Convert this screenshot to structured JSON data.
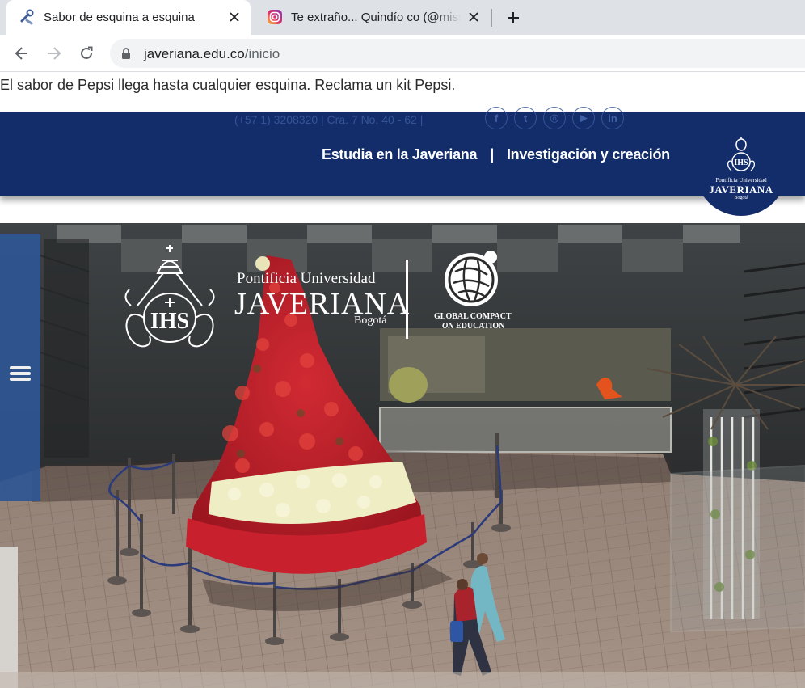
{
  "browser": {
    "tabs": [
      {
        "title": "Sabor de esquina a esquina",
        "icon": "tools-icon",
        "active": true
      },
      {
        "title": "Te extraño... Quindío co (@missin",
        "icon": "instagram-icon",
        "active": false
      }
    ],
    "url": {
      "domain": "javeriana.edu.co",
      "path": "/inicio"
    }
  },
  "ad": {
    "text": "El sabor de Pepsi llega hasta cualquier esquina. Reclama un kit Pepsi."
  },
  "header": {
    "contact": "(+57 1) 3208320 | Cra. 7 No. 40 - 62 |",
    "socials": [
      {
        "name": "facebook-icon",
        "glyph": "f"
      },
      {
        "name": "twitter-icon",
        "glyph": "t"
      },
      {
        "name": "instagram-icon",
        "glyph": "◎"
      },
      {
        "name": "youtube-icon",
        "glyph": "▶"
      },
      {
        "name": "linkedin-icon",
        "glyph": "in"
      }
    ],
    "nav": [
      "Estudia en la Javeriana",
      "Investigación y creación"
    ],
    "nav_separator": "|",
    "crest": {
      "line1": "Pontificia Universidad",
      "line2": "JAVERIANA",
      "line3": "Bogotá"
    }
  },
  "hero": {
    "brand": {
      "line1": "Pontificia Universidad",
      "line2": "JAVERIANA",
      "line3": "Bogotá",
      "gc_line1": "GLOBAL COMPACT",
      "gc_line2_italic": "ON",
      "gc_line2": " EDUCATION"
    }
  },
  "colors": {
    "header_bg": "#132d6b",
    "tabstrip_bg": "#dee1e6",
    "tree_red": "#c8202d",
    "tree_cream": "#efedc4",
    "menu_panel": "#2f5694"
  }
}
